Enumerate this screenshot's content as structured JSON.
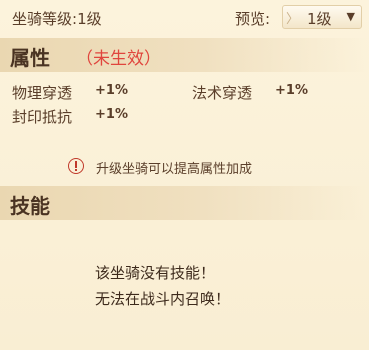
{
  "header": {
    "mount_level_label": "坐骑等级:",
    "mount_level_value": "1级",
    "preview_label": "预览:",
    "preview_selected": "1级"
  },
  "attributes": {
    "title": "属性",
    "status": "（未生效）",
    "items": [
      {
        "name": "物理穿透",
        "value": "+1%"
      },
      {
        "name": "法术穿透",
        "value": "+1%"
      },
      {
        "name": "封印抵抗",
        "value": "+1%"
      }
    ],
    "tip": "升级坐骑可以提高属性加成"
  },
  "skills": {
    "title": "技能",
    "message_line1": "该坐骑没有技能！",
    "message_line2": "无法在战斗内召唤！"
  },
  "colors": {
    "background": "#fbf1d9",
    "text": "#5a3e2a",
    "status_red": "#e0453d",
    "tip_icon": "#c0392b"
  },
  "icons": {
    "tip": "exclamation-circle-icon",
    "dropdown": "triangle-down-icon",
    "prev": "chevron-right-icon"
  }
}
